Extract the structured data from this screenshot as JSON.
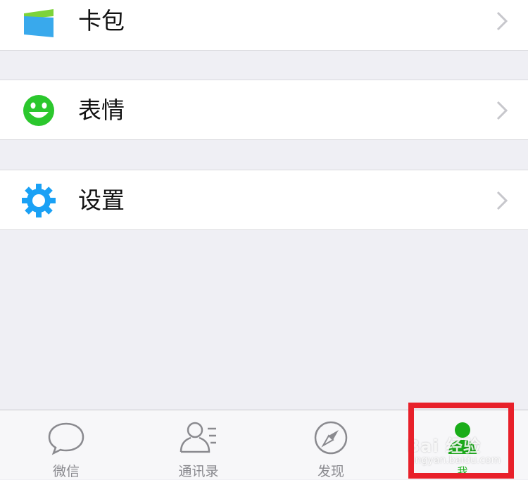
{
  "menu": {
    "items": [
      {
        "label": "卡包",
        "icon": "card-wallet-icon"
      },
      {
        "label": "表情",
        "icon": "smiley-icon"
      },
      {
        "label": "设置",
        "icon": "gear-icon"
      }
    ]
  },
  "tabbar": {
    "tabs": [
      {
        "label": "微信",
        "icon": "chat-bubble-icon",
        "active": false
      },
      {
        "label": "通讯录",
        "icon": "contacts-icon",
        "active": false
      },
      {
        "label": "发现",
        "icon": "compass-icon",
        "active": false
      },
      {
        "label": "我",
        "icon": "person-icon",
        "active": true
      }
    ]
  },
  "watermark": {
    "main": "Bai 经验",
    "sub": "jingyan.baidu.com"
  },
  "colors": {
    "active_green": "#1aad19",
    "inactive_gray": "#8a8a8f",
    "highlight_red": "#e8202a",
    "gear_blue": "#1aa1f5",
    "smiley_green": "#2bc72d"
  }
}
